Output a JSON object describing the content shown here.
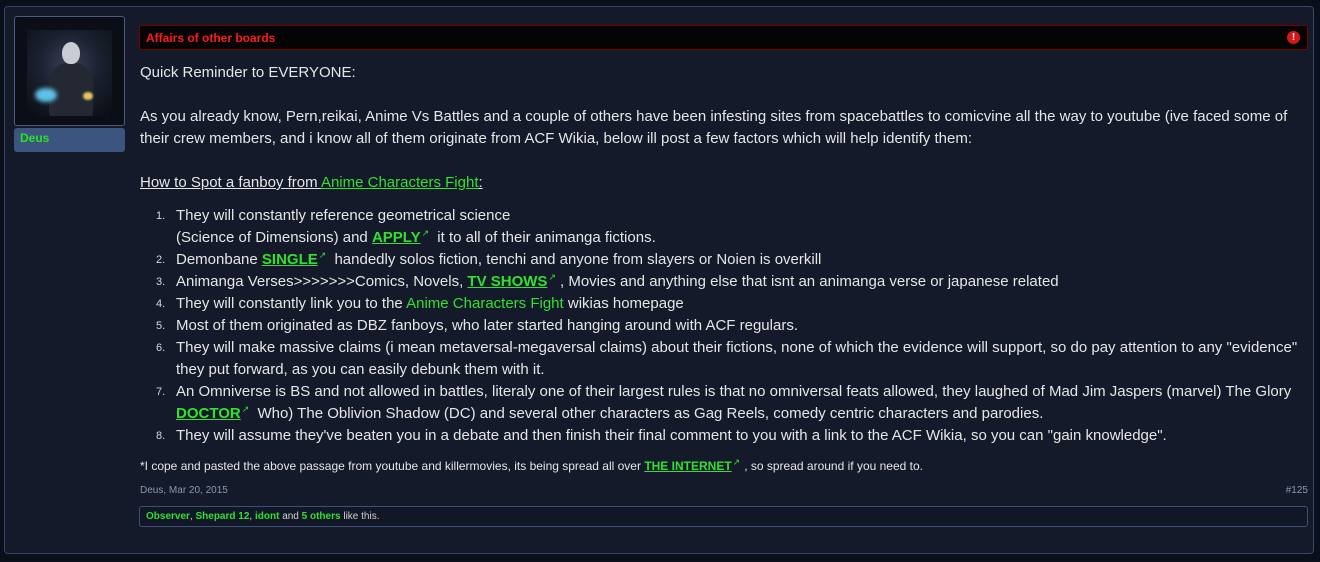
{
  "user": {
    "name": "Deus"
  },
  "prefix": {
    "label": "Affairs of other boards"
  },
  "message": {
    "intro": "Quick Reminder to EVERYONE:",
    "body": "As you already know, Pern,reikai, Anime Vs Battles and a couple of others have been infesting sites from spacebattles to comicvine all the way to youtube (ive faced some of their crew members, and i know all of them originate from ACF Wikia, below ill post a few factors which will help identify them:",
    "howto_prefix": "How to Spot a fanboy from ",
    "howto_highlight": "Anime Characters Fight",
    "howto_suffix": ":",
    "items": {
      "i1_a": "They will constantly reference geometrical science",
      "i1_b": "(Science of Dimensions) and ",
      "i1_link": "APPLY",
      "i1_c": " it to all of their animanga fictions.",
      "i2_a": "Demonbane ",
      "i2_link": "SINGLE",
      "i2_b": " handedly solos fiction, tenchi and anyone from slayers or Noien is overkill",
      "i3_a": "Animanga Verses>>>>>>>Comics, Novels, ",
      "i3_link": "TV SHOWS",
      "i3_b": ", Movies and anything else that isnt an animanga verse or japanese related",
      "i4_a": "They will constantly link you to the ",
      "i4_highlight": "Anime Characters Fight",
      "i4_b": " wikias homepage",
      "i5": "Most of them originated as DBZ fanboys, who later started hanging around with ACF regulars.",
      "i6": "They will make massive claims (i mean metaversal-megaversal claims) about their fictions, none of which the evidence will support, so do pay attention to any \"evidence\" they put forward, as you can easily debunk them with it.",
      "i7_a": "An Omniverse is BS and not allowed in battles, literaly one of their largest rules is that no omniversal feats allowed, they laughed of Mad Jim Jaspers (marvel) The Glory ",
      "i7_link": "DOCTOR",
      "i7_b": " Who) The Oblivion Shadow (DC) and several other characters as Gag Reels, comedy centric characters and parodies.",
      "i8": "They will assume they've beaten you in a debate and then finish their final comment to you with a link to the ACF Wikia, so you can \"gain knowledge\"."
    },
    "footnote_a": "*I cope and pasted the above passage from youtube and killermovies, its being spread all over ",
    "footnote_link": "THE INTERNET",
    "footnote_b": ", so spread around if you need to."
  },
  "meta": {
    "author": "Deus",
    "date": "Mar 20, 2015",
    "post_number": "#125"
  },
  "likes": {
    "user1": "Observer",
    "user2": "Shepard 12",
    "user3": "idont",
    "others": "5 others",
    "and": "and",
    "suffix": "like this."
  },
  "icons": {
    "alert": "exclamation-circle-icon",
    "external": "external-link-icon"
  },
  "colors": {
    "prefix_text": "#ff1a1a",
    "highlight_green": "#31e031",
    "background": "#141a2a",
    "username_bar": "#3c557f"
  }
}
